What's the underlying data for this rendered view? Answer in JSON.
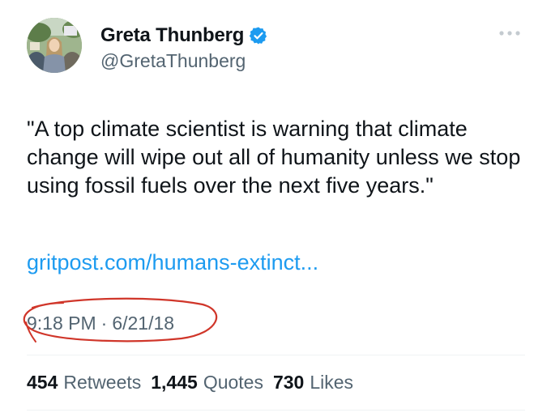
{
  "author": {
    "display_name": "Greta Thunberg",
    "handle": "@GretaThunberg",
    "verified": true
  },
  "tweet": {
    "text": "\"A top climate scientist is warning that climate change will wipe out all of humanity unless we stop using fossil fuels over the next five years.\"",
    "link_text": "gritpost.com/humans-extinct...",
    "time": "9:18 PM",
    "separator": "·",
    "date": "6/21/18"
  },
  "stats": {
    "retweets_count": "454",
    "retweets_label": "Retweets",
    "quotes_count": "1,445",
    "quotes_label": "Quotes",
    "likes_count": "730",
    "likes_label": "Likes"
  },
  "colors": {
    "link": "#1d9bf0",
    "secondary_text": "#536471",
    "verified_badge": "#1d9bf0",
    "annotation": "#d0362a"
  },
  "icons": {
    "verified": "verified-badge-icon",
    "more": "more-options-icon"
  }
}
